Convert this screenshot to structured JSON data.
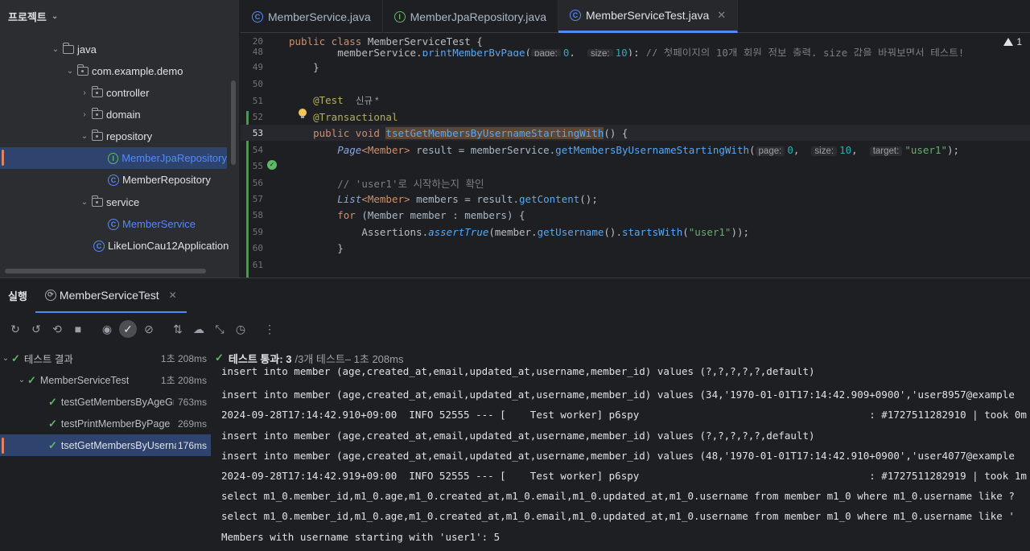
{
  "project_panel": {
    "title": "프로젝트",
    "tree": [
      {
        "label": "java",
        "kind": "folder"
      },
      {
        "label": "com.example.demo",
        "kind": "package"
      },
      {
        "label": "controller",
        "kind": "package"
      },
      {
        "label": "domain",
        "kind": "package"
      },
      {
        "label": "repository",
        "kind": "package"
      },
      {
        "label": "MemberJpaRepository",
        "kind": "interface"
      },
      {
        "label": "MemberRepository",
        "kind": "class"
      },
      {
        "label": "service",
        "kind": "package"
      },
      {
        "label": "MemberService",
        "kind": "class"
      },
      {
        "label": "LikeLionCau12Application",
        "kind": "class"
      }
    ]
  },
  "editor": {
    "tabs": [
      {
        "label": "MemberService.java",
        "icon": "class-icon"
      },
      {
        "label": "MemberJpaRepository.java",
        "icon": "interface-icon"
      },
      {
        "label": "MemberServiceTest.java",
        "icon": "test-class-icon",
        "active": true
      }
    ],
    "warning_count": "1",
    "lines": {
      "l20": "20",
      "l48": "48",
      "l49": "49",
      "l50": "50",
      "l51": "51",
      "l52": "52",
      "l53": "53",
      "l54": "54",
      "l55": "55",
      "l56": "56",
      "l57": "57",
      "l58": "58",
      "l59": "59",
      "l60": "60",
      "l61": "61"
    },
    "code": {
      "c20_kw": "public class ",
      "c20_name": "MemberServiceTest",
      "c20_rest": " {",
      "c48_a": "memberService.",
      "c48_fn": "printMemberByPage",
      "c48_paren": "(",
      "c48_hint_page": "page:",
      "c48_page": "0",
      "c48_hint_size": "size:",
      "c48_size": "10",
      "c48_end": "); ",
      "c48_cmt": "// 첫페이지의 10개 회원 정보 출력, size 값을 바꿔보면서 테스트!",
      "c49": "}",
      "c51_ann": "@Test",
      "c51_new": "신규 *",
      "c52_ann": "@Transactional",
      "c53_kw": "public void ",
      "c53_name": "tsetGetMembersByUsernameStartingWith",
      "c53_rest": "() {",
      "c54_type": "Page",
      "c54_gen": "<Member>",
      "c54_var": " result = memberService.",
      "c54_fn": "getMembersByUsernameStartingWith",
      "c54_paren": "(",
      "c54_hint_page": "page:",
      "c54_page": "0",
      "c54_hint_size": "size:",
      "c54_size": "10",
      "c54_hint_target": "target:",
      "c54_target": "\"user1\"",
      "c54_end": ");",
      "c56_cmt": "// 'user1'로 시작하는지 확인",
      "c57_type": "List",
      "c57_gen": "<Member>",
      "c57_var": " members = result.",
      "c57_fn": "getContent",
      "c57_end": "();",
      "c58_kw": "for ",
      "c58_a": "(Member member : members) {",
      "c59_a": "Assertions.",
      "c59_fn": "assertTrue",
      "c59_b": "(member.",
      "c59_fn2": "getUsername",
      "c59_c": "().",
      "c59_fn3": "startsWith",
      "c59_d": "(",
      "c59_str": "\"user1\"",
      "c59_e": "));",
      "c60": "}"
    }
  },
  "run_panel": {
    "title": "실행",
    "tab_label": "MemberServiceTest",
    "status": {
      "prefix": "테스트 통과: 3",
      "suffix": "/3개 테스트",
      "time": " – 1초 208ms"
    },
    "tests": [
      {
        "name": "테스트 결과",
        "time": "1초 208ms"
      },
      {
        "name": "MemberServiceTest",
        "time": "1초 208ms"
      },
      {
        "name": "testGetMembersByAgeGr",
        "time": "763ms"
      },
      {
        "name": "testPrintMemberByPage",
        "time": "269ms"
      },
      {
        "name": "tsetGetMembersByUserna",
        "time": "176ms"
      }
    ],
    "log": [
      "insert into member (age,created_at,email,updated_at,username,member_id) values (?,?,?,?,?,default)",
      "insert into member (age,created_at,email,updated_at,username,member_id) values (34,'1970-01-01T17:14:42.909+0900','user8957@example",
      "2024-09-28T17:14:42.910+09:00  INFO 52555 --- [    Test worker] p6spy                                      : #1727511282910 | took 0m",
      "insert into member (age,created_at,email,updated_at,username,member_id) values (?,?,?,?,?,default)",
      "insert into member (age,created_at,email,updated_at,username,member_id) values (48,'1970-01-01T17:14:42.910+0900','user4077@example",
      "2024-09-28T17:14:42.919+09:00  INFO 52555 --- [    Test worker] p6spy                                      : #1727511282919 | took 1m",
      "select m1_0.member_id,m1_0.age,m1_0.created_at,m1_0.email,m1_0.updated_at,m1_0.username from member m1_0 where m1_0.username like ?",
      "select m1_0.member_id,m1_0.age,m1_0.created_at,m1_0.email,m1_0.updated_at,m1_0.username from member m1_0 where m1_0.username like '",
      "Members with username starting with 'user1': 5"
    ]
  }
}
